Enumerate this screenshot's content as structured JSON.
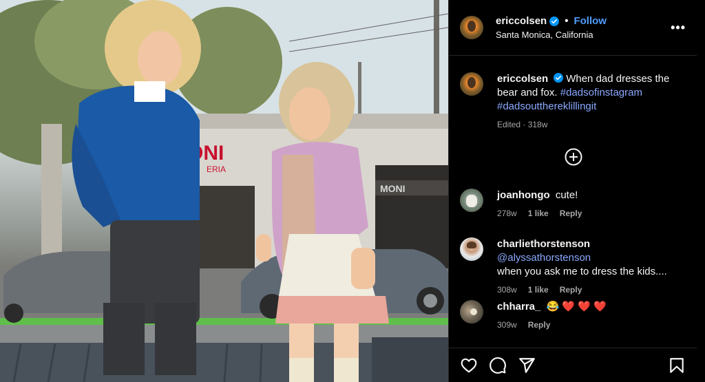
{
  "post": {
    "username": "ericcolsen",
    "follow_label": "Follow",
    "separator": "•",
    "location": "Santa Monica, California",
    "more_label": "•••"
  },
  "photo": {
    "storefront_sign": "ONI",
    "storefront_sub": "ERIA",
    "right_sign": "MONI",
    "accent_color": "#c8102e"
  },
  "caption": {
    "username": "ericcolsen",
    "text": "When dad dresses the bear and fox.",
    "tag1": "#dadsofinstagram",
    "tag2": "#dadsoutthereklillingit",
    "meta": "Edited · 318w"
  },
  "comments": [
    {
      "username": "joanhongo",
      "text": "cute!",
      "age": "278w",
      "likes": "1 like",
      "reply": "Reply"
    },
    {
      "username": "charliethorstenson",
      "mention": "@alyssathorstenson",
      "text": "when you ask me to dress the kids....",
      "age": "308w",
      "likes": "1 like",
      "reply": "Reply"
    },
    {
      "username": "chharra_",
      "text": "😂 ❤️ ❤️ ❤️",
      "age": "309w",
      "reply": "Reply"
    }
  ],
  "colors": {
    "link": "#4f9dff",
    "hashtag": "#8aa8ff",
    "verified": "#0095f6"
  },
  "icons": [
    "heart-icon",
    "comment-icon",
    "share-icon",
    "bookmark-icon",
    "add-comment-icon",
    "more-icon",
    "verified-icon"
  ]
}
